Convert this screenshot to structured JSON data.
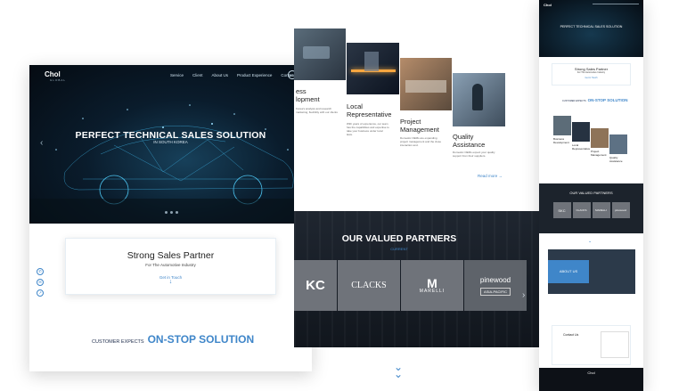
{
  "left": {
    "logo": "Chol",
    "logo_sub": "GLOBAL",
    "nav": [
      "Service",
      "Client",
      "About Us",
      "Product Experience",
      "Contact"
    ],
    "lang": "EN",
    "hero_title": "PERFECT TECHNICAL SALES SOLUTION",
    "hero_sub": "IN SOUTH KOREA",
    "card_title": "Strong Sales Partner",
    "card_sub": "For The Automotive Industry",
    "card_link": "Get in Touch",
    "expect_prefix": "CUSTOMER EXPECTS",
    "expect_main": "ON-STOP SOLUTION"
  },
  "middle": {
    "services": [
      {
        "title": "ess\nlopment",
        "body": "Korea's analysis\nand research\nmarketing, flexibility\nwith our clients"
      },
      {
        "title": "Local\nRepresentative",
        "body": "With years of experience, our team has the capabilities and expertise to take your business under local laws."
      },
      {
        "title": "Project\nManagement",
        "body": "Domestic OEMs are expanding project management and the close interaction and."
      },
      {
        "title": "Quality\nAssistance",
        "body": "Domestic OEMs expect your quality support from their suppliers."
      }
    ],
    "read_more": "Read more",
    "partners_title": "OUR VALUED PARTNERS",
    "partners_sub": "CURRENT",
    "partner_logos": [
      "KC",
      "CLACKS",
      "MARELLI",
      "pinewood"
    ],
    "partner_captions": [
      "",
      "",
      "",
      "ASIA-PACIFIC"
    ]
  },
  "right": {
    "logo": "Chol",
    "hero_title": "PERFECT TECHNICAL SALES SOLUTION",
    "card_title": "Strong Sales Partner",
    "card_sub": "For The Automotive Industry",
    "card_link": "Get in Touch",
    "expect_prefix": "CUSTOMER EXPECTS",
    "expect_main": "ON-STOP SOLUTION",
    "services": [
      "Business\nDevelopment",
      "Local\nRepresentative",
      "Project\nManagement",
      "Quality\nAssistance"
    ],
    "partners_title": "OUR VALUED PARTNERS",
    "partner_logos": [
      "SKC",
      "CLACKS",
      "MARELLI",
      "pinewood"
    ],
    "about_title": "ABOUT US",
    "contact_title": "Contact Us",
    "footer_logo": "Chol"
  }
}
